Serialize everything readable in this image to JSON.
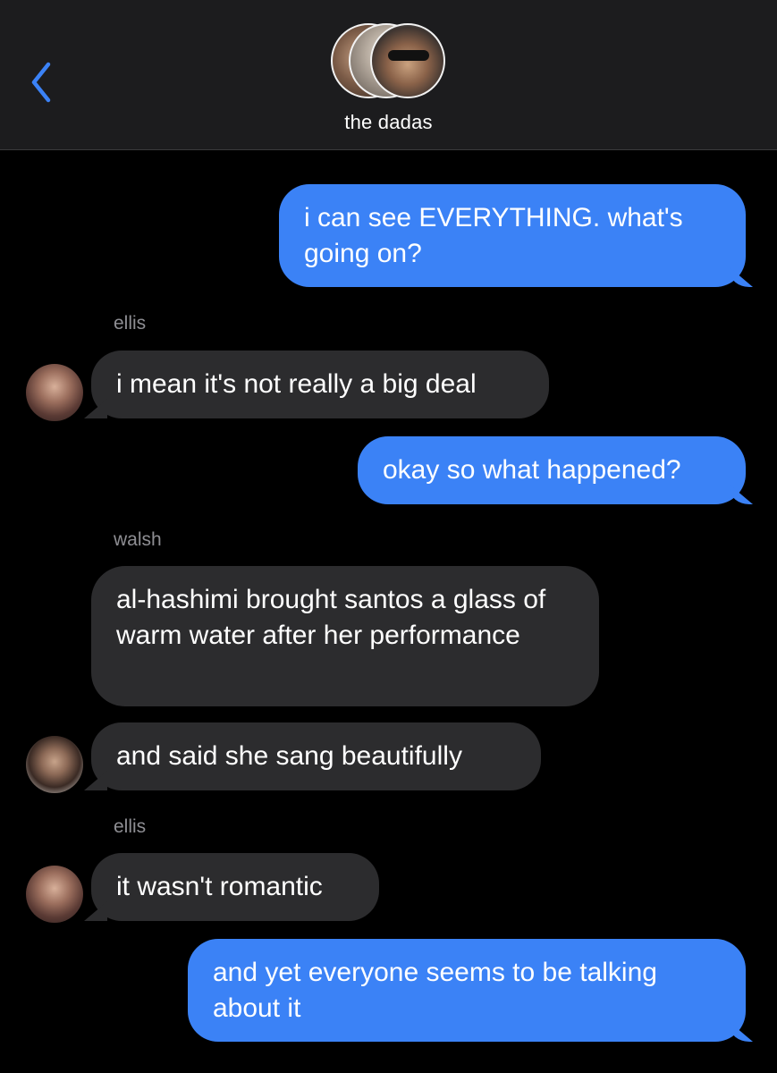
{
  "header": {
    "back_icon": "chevron-left-icon",
    "title": "the dadas",
    "accent_color": "#3b82f6"
  },
  "messages": [
    {
      "direction": "sent",
      "text": "i can see EVERYTHING. what's going on?"
    },
    {
      "direction": "received",
      "sender": "ellis",
      "text": "i mean it's not really a big deal"
    },
    {
      "direction": "sent",
      "text": "okay so what happened?"
    },
    {
      "direction": "received",
      "sender": "walsh",
      "text": "al-hashimi brought santos a glass of warm water after her performance"
    },
    {
      "direction": "received",
      "text": "and said she sang beautifully"
    },
    {
      "direction": "received",
      "sender": "ellis",
      "text": "it wasn't romantic"
    },
    {
      "direction": "sent",
      "text": "and yet everyone seems to be talking about it"
    }
  ],
  "colors": {
    "background": "#000000",
    "header_background": "#1c1c1e",
    "sent_bubble": "#3b82f6",
    "received_bubble": "#2c2c2e",
    "sender_label": "#8e8e93"
  }
}
